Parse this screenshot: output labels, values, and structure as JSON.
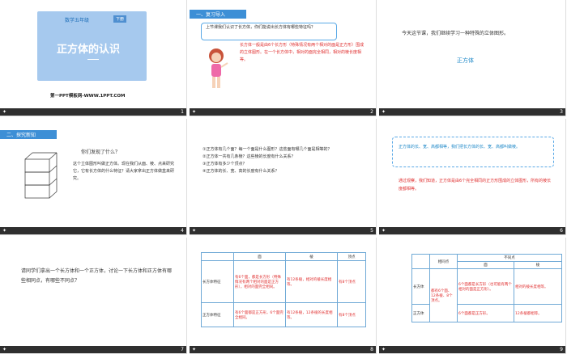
{
  "slides": [
    {
      "id": 1,
      "page": "1",
      "grade_label": "数学五年级",
      "volume_badge": "下册",
      "title": "正方体的认识",
      "footer_brand": "第一PPT模板网-WWW.1PPT.COM"
    },
    {
      "id": 2,
      "page": "2",
      "section": "一、复习导入",
      "bubble": "上节课我们认识了长方体，你们能说出长方体有哪些特征吗？",
      "answer": "长方体一般是由6个长方形（特殊情况有两个相对的面是正方形）围成的立体图形。在一个长方体中，相对的面完全相同，相对的棱长度相等。"
    },
    {
      "id": 3,
      "page": "3",
      "text": "今天这节课，我们继续学习一种特殊的立体图形。",
      "highlight": "正方体"
    },
    {
      "id": 4,
      "page": "4",
      "section": "二、探究新知",
      "question": "你们发现了什么？",
      "body": "这个立体图形叫做正方体。现在我们从面、棱、点来研究它，它有长方体的什么特征？请大家拿出正方体做盒来研究。"
    },
    {
      "id": 5,
      "page": "5",
      "lines": [
        "①正方体有几个面？每一个面是什么图形？这些面有哪几个面是相等的？",
        "②正方体一共有几条棱？这些棱的长度有什么关系？",
        "③正方体有多少个顶点？",
        "④正方体的长、宽、高的长度有什么关系？"
      ]
    },
    {
      "id": 6,
      "page": "6",
      "box_text": "正方体的长、宽、高都相等，我们把长方体的长、宽、高都叫做棱。",
      "red_text": "通过观察，我们知道，正方体是由6个完全相同的正方形围成的立体图形，所有的棱长度都相等。"
    },
    {
      "id": 7,
      "page": "7",
      "text": "请同学们拿出一个长方体和一个正方体，讨论一下长方体和正方体有哪些相同点，有哪些不同点？"
    },
    {
      "id": 8,
      "page": "8",
      "headers": [
        "",
        "面",
        "棱",
        "顶点"
      ],
      "rows": [
        {
          "label": "长方体特征",
          "face": "有6个面，都是长方形（特殊情况有两个相对的面是正方形），相对的面完全相同。",
          "edge": "有12条棱，相对的棱长度相等。",
          "vertex": "有8个顶点"
        },
        {
          "label": "正方体特征",
          "face": "有6个面都是正方形，6个面完全相同。",
          "edge": "有12条棱，12条棱的长度相等。",
          "vertex": "有8个顶点"
        }
      ]
    },
    {
      "id": 9,
      "page": "9",
      "header_same": "相同点",
      "header_diff": "不同点",
      "sub_face": "面",
      "sub_edge": "棱",
      "rows": [
        {
          "label": "长方体",
          "same": "都有6个面、12条棱、8个顶点。",
          "face": "6个面都是长方形（也可能有两个相对的面是正方形）。",
          "edge": "相对的棱长度相等。"
        },
        {
          "label": "正方体",
          "same": "",
          "face": "6个面都是正方形。",
          "edge": "12条棱都相等。"
        }
      ]
    }
  ]
}
